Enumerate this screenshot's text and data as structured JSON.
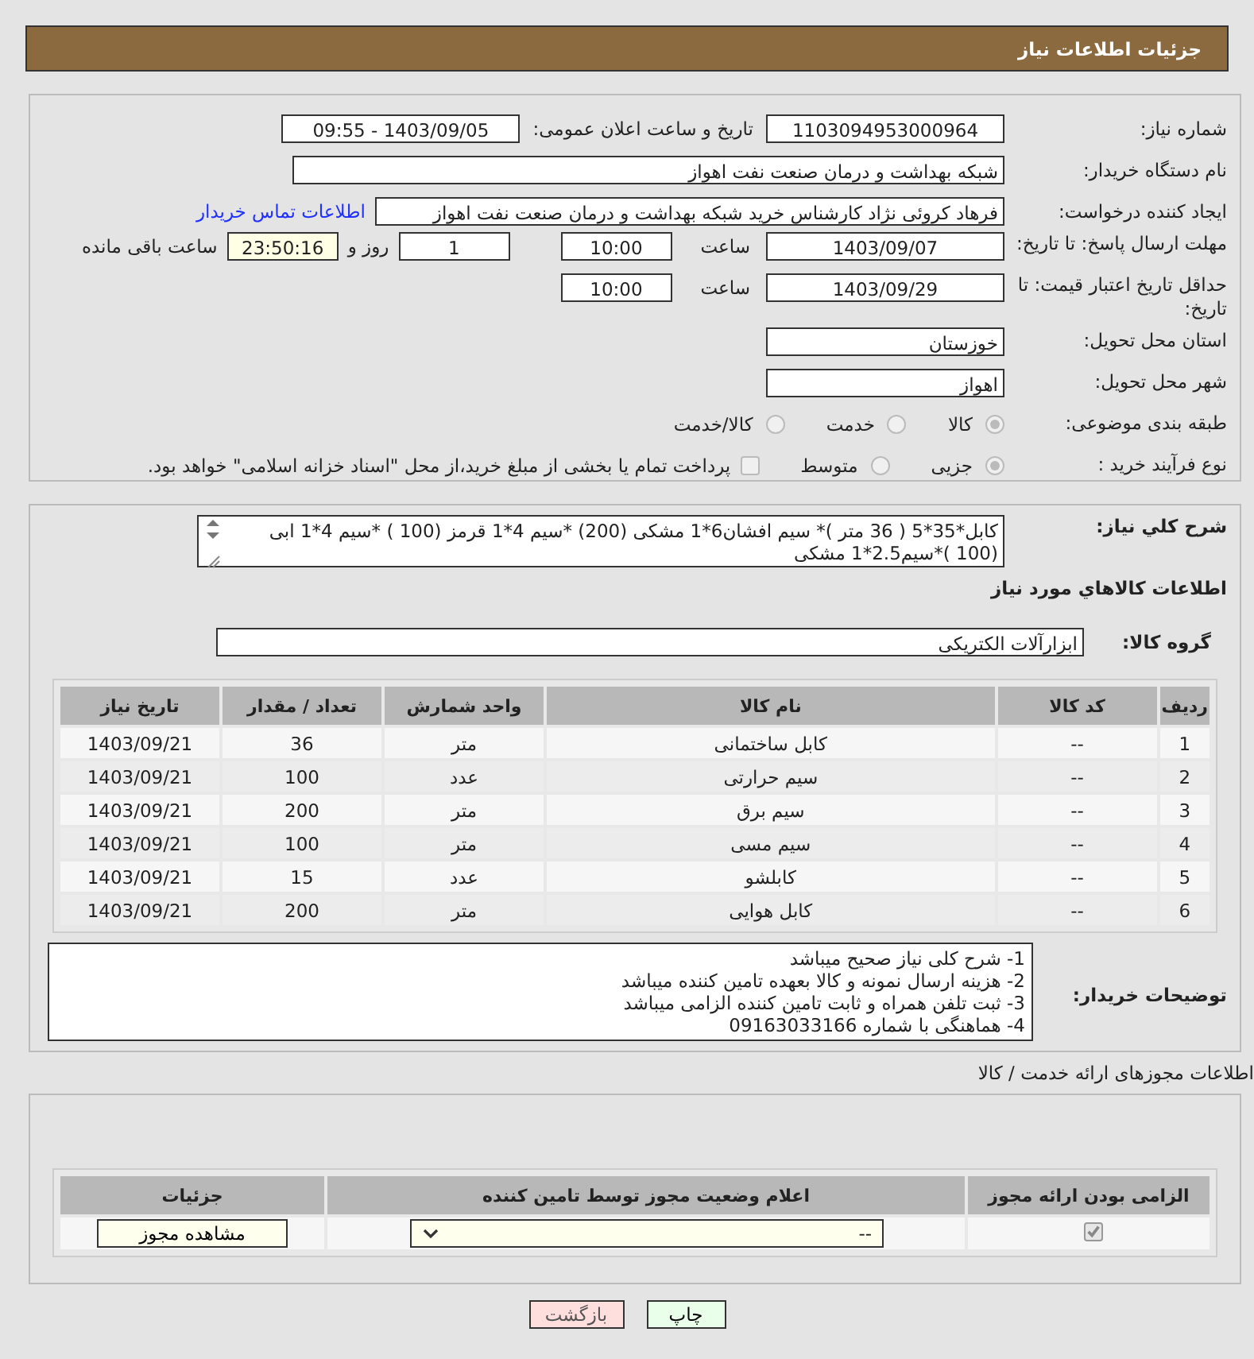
{
  "header": {
    "title": "جزئیات اطلاعات نیاز"
  },
  "need_number": {
    "label": "شماره نیاز:",
    "value": "1103094953000964"
  },
  "announce": {
    "label": "تاریخ و ساعت اعلان عمومی:",
    "value": "1403/09/05 - 09:55"
  },
  "buyer_org": {
    "label": "نام دستگاه خریدار:",
    "value": "شبکه بهداشت و درمان صنعت نفت اهواز"
  },
  "requester": {
    "label": "ایجاد کننده درخواست:",
    "value": "فرهاد کروئی نژاد کارشناس خرید شبکه بهداشت و درمان صنعت نفت اهواز",
    "link": "اطلاعات تماس خریدار"
  },
  "reply_deadline": {
    "label": "مهلت ارسال پاسخ: تا تاریخ:",
    "date": "1403/09/07",
    "time_label": "ساعت",
    "time": "10:00",
    "days": "1",
    "days_label": "روز و",
    "remaining": "23:50:16",
    "remaining_label": "ساعت باقی مانده"
  },
  "price_validity": {
    "label": "حداقل تاریخ اعتبار قیمت: تا تاریخ:",
    "date": "1403/09/29",
    "time_label": "ساعت",
    "time": "10:00"
  },
  "province": {
    "label": "استان محل تحویل:",
    "value": "خوزستان"
  },
  "city": {
    "label": "شهر محل تحویل:",
    "value": "اهواز"
  },
  "category": {
    "label": "طبقه بندی موضوعی:",
    "options": [
      {
        "label": "کالا",
        "selected": true
      },
      {
        "label": "خدمت",
        "selected": false
      },
      {
        "label": "کالا/خدمت",
        "selected": false
      }
    ]
  },
  "process": {
    "label": "نوع فرآیند خرید :",
    "options": [
      {
        "label": "جزیی",
        "selected": true
      },
      {
        "label": "متوسط",
        "selected": false
      }
    ],
    "treasury": {
      "checked": false,
      "label": "پرداخت تمام یا بخشی از مبلغ خرید،از محل \"اسناد خزانه اسلامی\" خواهد بود."
    }
  },
  "description": {
    "label": "شرح کلي نياز:",
    "value": "کابل*35*5 ( 36 متر )* سیم افشان6*1 مشکی (200) *سیم 4*1 قرمز (100 ) *سیم 4*1 ابی (100 )*سیم2.5*1 مشکی"
  },
  "items_title": "اطلاعات کالاهاي مورد نياز",
  "goods_group": {
    "label": "گروه کالا:",
    "value": "ابزارآلات الکتریکی"
  },
  "items_table": {
    "columns": [
      "ردیف",
      "کد کالا",
      "نام کالا",
      "واحد شمارش",
      "تعداد / مقدار",
      "تاریخ نیاز"
    ],
    "rows": [
      [
        "1",
        "--",
        "کابل ساختمانی",
        "متر",
        "36",
        "1403/09/21"
      ],
      [
        "2",
        "--",
        "سیم حرارتی",
        "عدد",
        "100",
        "1403/09/21"
      ],
      [
        "3",
        "--",
        "سیم برق",
        "متر",
        "200",
        "1403/09/21"
      ],
      [
        "4",
        "--",
        "سیم مسی",
        "متر",
        "100",
        "1403/09/21"
      ],
      [
        "5",
        "--",
        "کابلشو",
        "عدد",
        "15",
        "1403/09/21"
      ],
      [
        "6",
        "--",
        "کابل هوایی",
        "متر",
        "200",
        "1403/09/21"
      ]
    ]
  },
  "buyer_notes": {
    "label": "توضیحات خریدار:",
    "lines": [
      "1- شرح کلی نیاز صحیح میباشد",
      "2- هزینه ارسال نمونه و کالا بعهده تامین کننده میباشد",
      "3- ثبت تلفن همراه و ثابت تامین کننده الزامی میباشد",
      "4- هماهنگی با شماره 09163033166"
    ]
  },
  "licenses": {
    "title": "اطلاعات مجوزهای ارائه خدمت / کالا",
    "columns": [
      "الزامی بودن ارائه مجوز",
      "اعلام وضعیت مجوز توسط تامین کننده",
      "جزئیات"
    ],
    "rows": [
      {
        "required": true,
        "status": "--",
        "button": "مشاهده مجوز"
      }
    ]
  },
  "buttons": [
    {
      "label": "چاپ",
      "kind": "print"
    },
    {
      "label": "بازگشت",
      "kind": "back"
    }
  ]
}
